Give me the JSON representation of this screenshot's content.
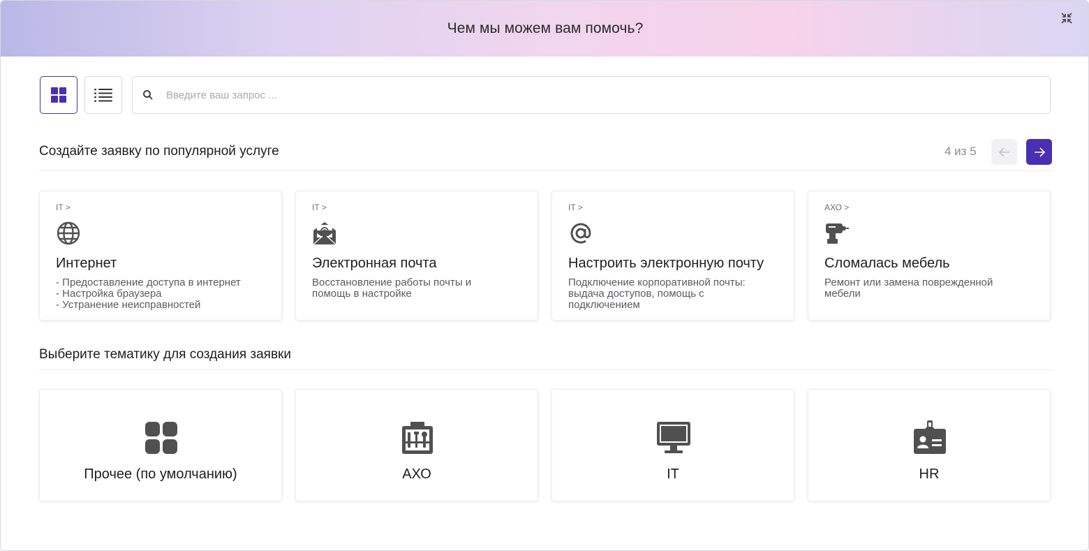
{
  "header": {
    "title": "Чем мы можем вам помочь?"
  },
  "toolbar": {
    "search_placeholder": "Введите ваш запрос ..."
  },
  "popular": {
    "title": "Создайте заявку по популярной услуге",
    "pager_text": "4 из 5",
    "cards": [
      {
        "crumb": "IT >",
        "icon": "globe-icon",
        "title": "Интернет",
        "description": "- Предоставление доступа в интернет\n- Настройка браузера\n- Устранение неисправностей"
      },
      {
        "crumb": "IT >",
        "icon": "envelope-at-icon",
        "title": "Электронная почта",
        "description": "Восстановление работы почты и\nпомощь в настройке"
      },
      {
        "crumb": "IT >",
        "icon": "at-sign-icon",
        "title": "Настроить электронную почту",
        "description": "Подключение корпоративной почты:\nвыдача доступов, помощь с\nподключением"
      },
      {
        "crumb": "АХО >",
        "icon": "drill-icon",
        "title": "Сломалась мебель",
        "description": "Ремонт или замена поврежденной\nмебели"
      }
    ]
  },
  "topics": {
    "title": "Выберите тематику для создания заявки",
    "items": [
      {
        "label": "Прочее (по умолчанию)",
        "icon": "apps-grid-icon"
      },
      {
        "label": "АХО",
        "icon": "toolbox-icon"
      },
      {
        "label": "IT",
        "icon": "monitor-icon"
      },
      {
        "label": "HR",
        "icon": "id-badge-icon"
      }
    ]
  },
  "colors": {
    "accent": "#4a2fb0",
    "icon_gray": "#505050"
  }
}
